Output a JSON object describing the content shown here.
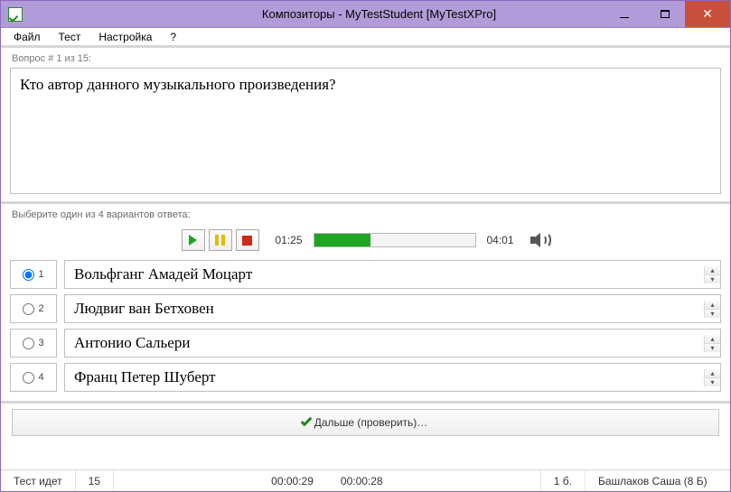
{
  "window": {
    "title": "Композиторы - MyTestStudent [MyTestXPro]"
  },
  "menu": {
    "file": "Файл",
    "test": "Тест",
    "settings": "Настройка",
    "help": "?"
  },
  "question": {
    "counter": "Вопрос # 1 из 15:",
    "text": "Кто автор данного музыкального произведения?"
  },
  "instruction": "Выберите один из 4 вариантов ответа:",
  "player": {
    "current": "01:25",
    "total": "04:01",
    "progress_pct": 35
  },
  "answers": [
    {
      "num": "1",
      "text": "Вольфганг Амадей Моцарт",
      "selected": true
    },
    {
      "num": "2",
      "text": "Людвиг ван Бетховен",
      "selected": false
    },
    {
      "num": "3",
      "text": "Антонио Сальери",
      "selected": false
    },
    {
      "num": "4",
      "text": "Франц Петер Шуберт",
      "selected": false
    }
  ],
  "next_button": "Дальше (проверить)…",
  "status": {
    "state": "Тест идет",
    "total_q": "15",
    "time1": "00:00:29",
    "time2": "00:00:28",
    "score": "1 б.",
    "user": "Башлаков Саша (8 Б)"
  }
}
